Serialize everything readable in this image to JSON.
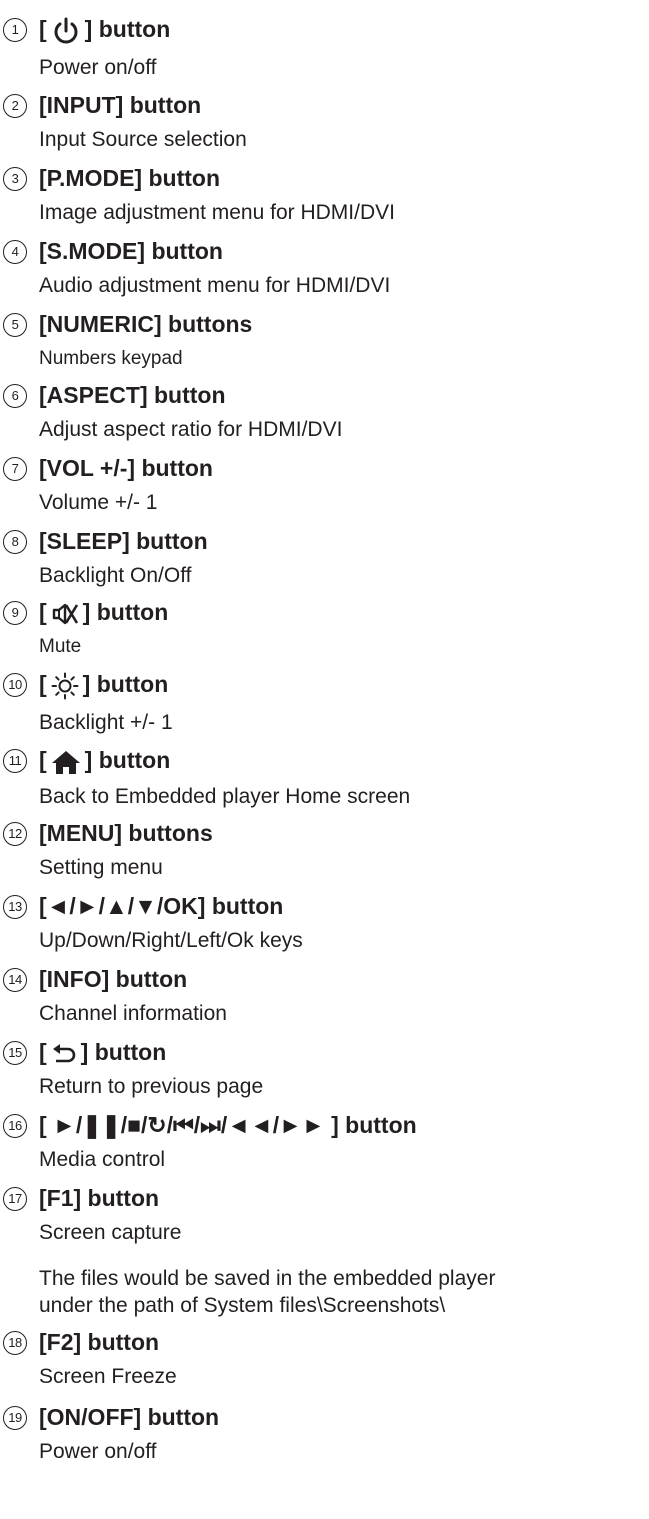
{
  "items": [
    {
      "num": "1",
      "title": "] button",
      "prefix": "[",
      "icon": "power-icon",
      "desc": [
        "Power on/off"
      ]
    },
    {
      "num": "2",
      "title": "[INPUT] button",
      "desc": [
        "Input Source selection"
      ]
    },
    {
      "num": "3",
      "title": "[P.MODE] button",
      "desc": [
        "Image adjustment menu for HDMI/DVI"
      ]
    },
    {
      "num": "4",
      "title": "[S.MODE] button",
      "desc": [
        "Audio adjustment menu for HDMI/DVI"
      ]
    },
    {
      "num": "5",
      "title": "[NUMERIC] buttons",
      "desc": [
        "Numbers keypad"
      ]
    },
    {
      "num": "6",
      "title": "[ASPECT] button",
      "desc": [
        "Adjust aspect ratio for HDMI/DVI"
      ]
    },
    {
      "num": "7",
      "title": "[VOL +/-] button",
      "desc": [
        "Volume +/- 1"
      ]
    },
    {
      "num": "8",
      "title": "[SLEEP] button",
      "desc": [
        "Backlight On/Off"
      ]
    },
    {
      "num": "9",
      "title": "] button",
      "prefix": "[",
      "icon": "mute-icon",
      "desc": [
        "Mute"
      ]
    },
    {
      "num": "10",
      "title": "] button",
      "prefix": "[",
      "icon": "brightness-icon",
      "desc": [
        "Backlight +/- 1"
      ]
    },
    {
      "num": "11",
      "title": "] button",
      "prefix": "[",
      "icon": "home-icon",
      "desc": [
        "Back to Embedded player Home screen"
      ]
    },
    {
      "num": "12",
      "title": "[MENU] buttons",
      "desc": [
        "Setting menu"
      ]
    },
    {
      "num": "13",
      "title": "[◄/►/▲/▼/OK] button",
      "desc": [
        "Up/Down/Right/Left/Ok keys"
      ]
    },
    {
      "num": "14",
      "title": "[INFO] button",
      "desc": [
        "Channel information"
      ]
    },
    {
      "num": "15",
      "title": "] button",
      "prefix": "[",
      "icon": "return-icon",
      "desc": [
        "Return to previous page"
      ]
    },
    {
      "num": "16",
      "title": "[ ►/❚❚/■/↻/⏮/⏭/◄◄/►► ] button",
      "desc": [
        "Media control"
      ]
    },
    {
      "num": "17",
      "title": "[F1] button",
      "desc": [
        "Screen capture",
        "The files would be saved in the embedded player",
        "under the path of System files\\Screenshots\\"
      ]
    },
    {
      "num": "18",
      "title": "[F2] button",
      "desc": [
        "Screen Freeze"
      ]
    },
    {
      "num": "19",
      "title": "[ON/OFF] button",
      "desc": [
        "Power on/off"
      ]
    }
  ]
}
